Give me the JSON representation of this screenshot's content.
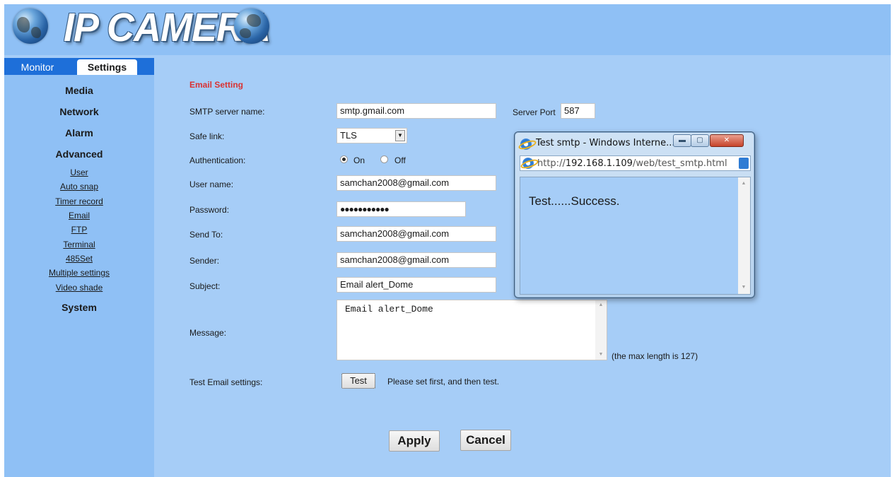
{
  "header": {
    "logo_text": "IP CAMERA"
  },
  "tabs": {
    "monitor": "Monitor",
    "settings": "Settings"
  },
  "sidebar": {
    "sections": [
      "Media",
      "Network",
      "Alarm",
      "Advanced"
    ],
    "advanced_items": [
      "User",
      "Auto snap",
      "Timer record",
      "Email",
      "FTP",
      "Terminal",
      "485Set",
      "Multiple settings",
      "Video shade"
    ],
    "last_section": "System"
  },
  "form": {
    "title": "Email Setting",
    "smtp_server": {
      "label": "SMTP server name:",
      "value": "smtp.gmail.com"
    },
    "server_port": {
      "label": "Server Port",
      "value": "587"
    },
    "safe_link": {
      "label": "Safe link:",
      "value": "TLS"
    },
    "authentication": {
      "label": "Authentication:",
      "on_label": "On",
      "off_label": "Off",
      "selected": "On"
    },
    "user_name": {
      "label": "User name:",
      "value": "samchan2008@gmail.com"
    },
    "password": {
      "label": "Password:",
      "value": "●●●●●●●●●●●"
    },
    "send_to": {
      "label": "Send To:",
      "value": "samchan2008@gmail.com"
    },
    "sender": {
      "label": "Sender:",
      "value": "samchan2008@gmail.com"
    },
    "subject": {
      "label": "Subject:",
      "value": "Email alert_Dome"
    },
    "message": {
      "label": "Message:",
      "value": "Email alert_Dome",
      "note": "(the max length is 127)"
    },
    "test": {
      "label": "Test Email settings:",
      "button": "Test",
      "hint": "Please set first, and then test."
    },
    "apply_button": "Apply",
    "cancel_button": "Cancel"
  },
  "popup": {
    "title": "Test smtp - Windows Interne...",
    "url_prefix": "http://",
    "url_host": "192.168.1.109",
    "url_path": "/web/test_smtp.html",
    "message": "Test......Success.",
    "min_glyph": "▬",
    "max_glyph": "▢",
    "close_glyph": "✕"
  },
  "colors": {
    "page_bg": "#a6cdf7",
    "header_bg": "#8fc0f5",
    "tab_strip": "#1e6fd9",
    "title_red": "#d93232"
  }
}
